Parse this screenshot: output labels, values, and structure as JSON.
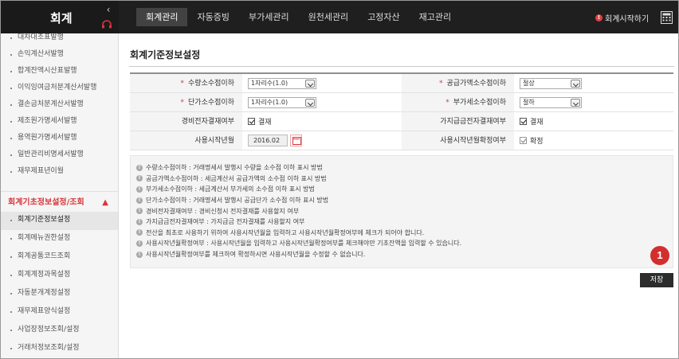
{
  "brand": {
    "title": "회계"
  },
  "menu": [
    "회계관리",
    "자동증빙",
    "부가세관리",
    "원천세관리",
    "고정자산",
    "재고관리"
  ],
  "menu_active": 0,
  "start_label": "회계시작하기",
  "sidebar": {
    "top_items": [
      "대차대조표발행",
      "손익계산서발행",
      "합계잔액시산표발행",
      "이익잉여금처분계산서발행",
      "결손금처분계산서발행",
      "제조원가명세서발행",
      "용역원가명세서발행",
      "일반관리비명세서발행",
      "재무제표년이월"
    ],
    "section": "회계기초정보설정/조회",
    "section_items": [
      "회계기준정보설정",
      "회계메뉴권한설정",
      "회계공통코드조회",
      "회계계정과목설정",
      "자동분개계정설정",
      "재무제표양식설정",
      "사업장정보조회/설정",
      "거래처정보조회/설정"
    ],
    "selected": 0
  },
  "page": {
    "title": "회계기준정보설정"
  },
  "form": {
    "qty_label": "수량소수점이하",
    "qty_value": "1자리수(1.0)",
    "supply_label": "공급가액소수점이하",
    "supply_value": "절상",
    "price_label": "단가소수점이하",
    "price_value": "1자리수(1.0)",
    "vat_label": "부가세소수점이하",
    "vat_value": "절하",
    "exp_label": "경비전자결재여부",
    "exp_value": "결재",
    "adv_label": "가지급금전자결재여부",
    "adv_value": "결재",
    "start_ym_label": "사용시작년월",
    "start_ym_value": "2016.02",
    "confirm_label": "사용시작년월확정여부",
    "confirm_value": "확정"
  },
  "notes": [
    "수량소수점이하 : 거래명세서 발행시 수량을 소수점 이하 표시 방법",
    "공급가액소수점이하 : 세금계산서 공급가액의 소수점 이하 표시 방법",
    "부가세소수점이하 : 세금계산서 부가세의 소수점 이하 표시 방법",
    "단가소수점이하 : 거래명세서 발행시 공급단가 소수점 이하 표시 방법",
    "경비전자결재여부 : 경비신청시 전자결재를 사용할지 여부",
    "가지급금전자결재여부 : 가지급금 전자결재를 사용할지 여부",
    "전산을 최초로 사용하기 위하여 사용시작년월을 입력하고 사용시작년월확정여부에 체크가 되어야 합니다.",
    "사용시작년월확정여부 : 사용시작년월을 입력하고 사용시작년월확정여부를 체크해야만 기초잔액을 입력할 수 있습니다.",
    "사용시작년월확정여부를 체크하여 확정하시면 사용시작년월을 수정할 수 없습니다."
  ],
  "note_icon": "!",
  "badge": "1",
  "save_label": "저장",
  "colors": {
    "accent": "#d7353a",
    "topbar": "#1f1f1f",
    "badge": "#d32f2f",
    "save": "#2c2c2c"
  }
}
